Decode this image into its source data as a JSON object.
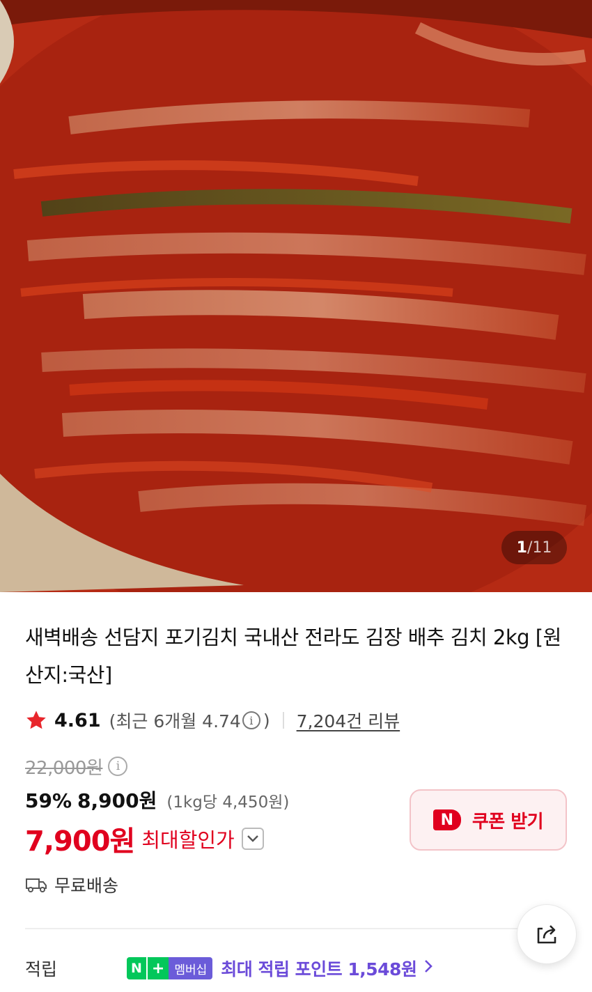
{
  "product": {
    "image_counter": {
      "current": "1",
      "separator": "/",
      "total": "11"
    },
    "title": "새벽배송 선담지 포기김치 국내산 전라도 김장 배추 김치 2kg [원산지:국산]",
    "rating": "4.61",
    "recent_rating": "(최근 6개월 4.74",
    "recent_rating_close": ")",
    "review_count": "7,204건 리뷰"
  },
  "price": {
    "original": "22,000원",
    "discount": "59%",
    "sale": "8,900원",
    "unit": "(1kg당 4,450원)",
    "final": "7,900원",
    "final_label": "최대할인가"
  },
  "coupon": {
    "badge": "N",
    "label": "쿠폰 받기"
  },
  "delivery": {
    "label": "무료배송"
  },
  "points": {
    "label": "적립",
    "badge_n": "N",
    "badge_plus": "+",
    "badge_member": "멤버십",
    "text": "최대 적립 포인트 1,548원"
  },
  "icons": {
    "star": "star-icon",
    "info": "info-icon",
    "chevron": "chevron-down-icon",
    "truck": "truck-icon",
    "share": "share-icon"
  },
  "colors": {
    "accent_red": "#e0001e",
    "npay_green": "#03c75a",
    "membership_purple": "#6b4bd9",
    "coupon_bg": "#fdf1f2"
  }
}
